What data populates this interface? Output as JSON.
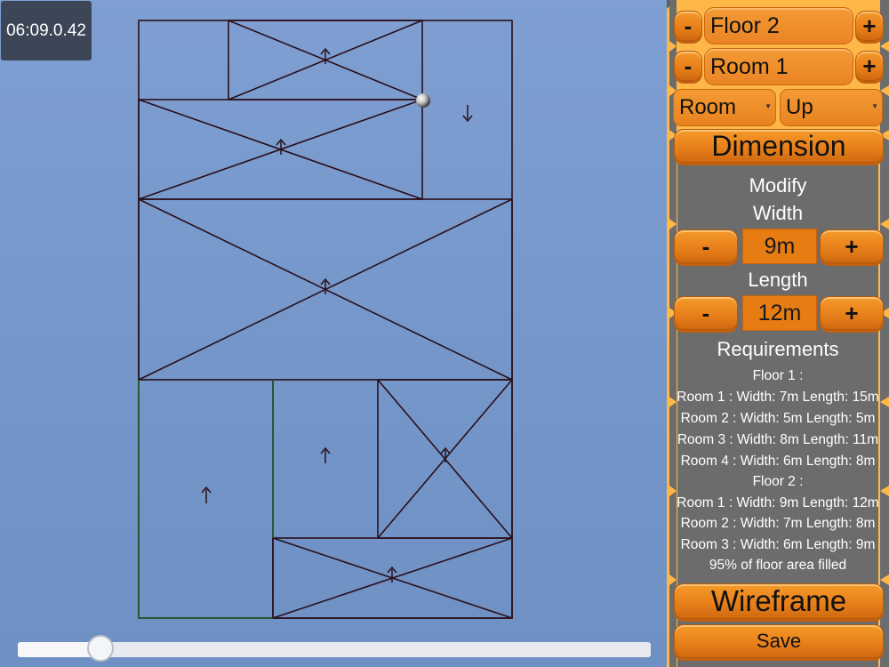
{
  "timer": "06:09.0.42",
  "floor_selector": {
    "minus": "-",
    "label": "Floor 2",
    "plus": "+"
  },
  "room_selector": {
    "minus": "-",
    "label": "Room 1",
    "plus": "+"
  },
  "type_dropdown": {
    "selected": "Room"
  },
  "direction_dropdown": {
    "selected": "Up"
  },
  "dimension_button": "Dimension",
  "modify": {
    "heading": "Modify",
    "width_label": "Width",
    "width_value": "9m",
    "length_label": "Length",
    "length_value": "12m",
    "minus": "-",
    "plus": "+"
  },
  "requirements": {
    "heading": "Requirements",
    "lines": [
      "Floor 1 :",
      "Room 1 : Width: 7m  Length: 15m",
      "Room 2 : Width: 5m  Length: 5m",
      "Room 3 : Width: 8m  Length: 11m",
      "Room 4 : Width: 6m  Length: 8m",
      "Floor 2 :",
      "Room 1 : Width: 9m  Length: 12m",
      "Room 2 : Width: 7m  Length: 8m",
      "Room 3 : Width: 6m  Length: 9m",
      "95% of floor area filled"
    ]
  },
  "wireframe_button": "Wireframe",
  "save_button": "Save",
  "slider": {
    "value": 0.13
  },
  "colors": {
    "accent": "#e8801a",
    "panel_bg": "#ffb847",
    "panel_grey": "#6d6c6c",
    "line": "#2a0f1a"
  }
}
